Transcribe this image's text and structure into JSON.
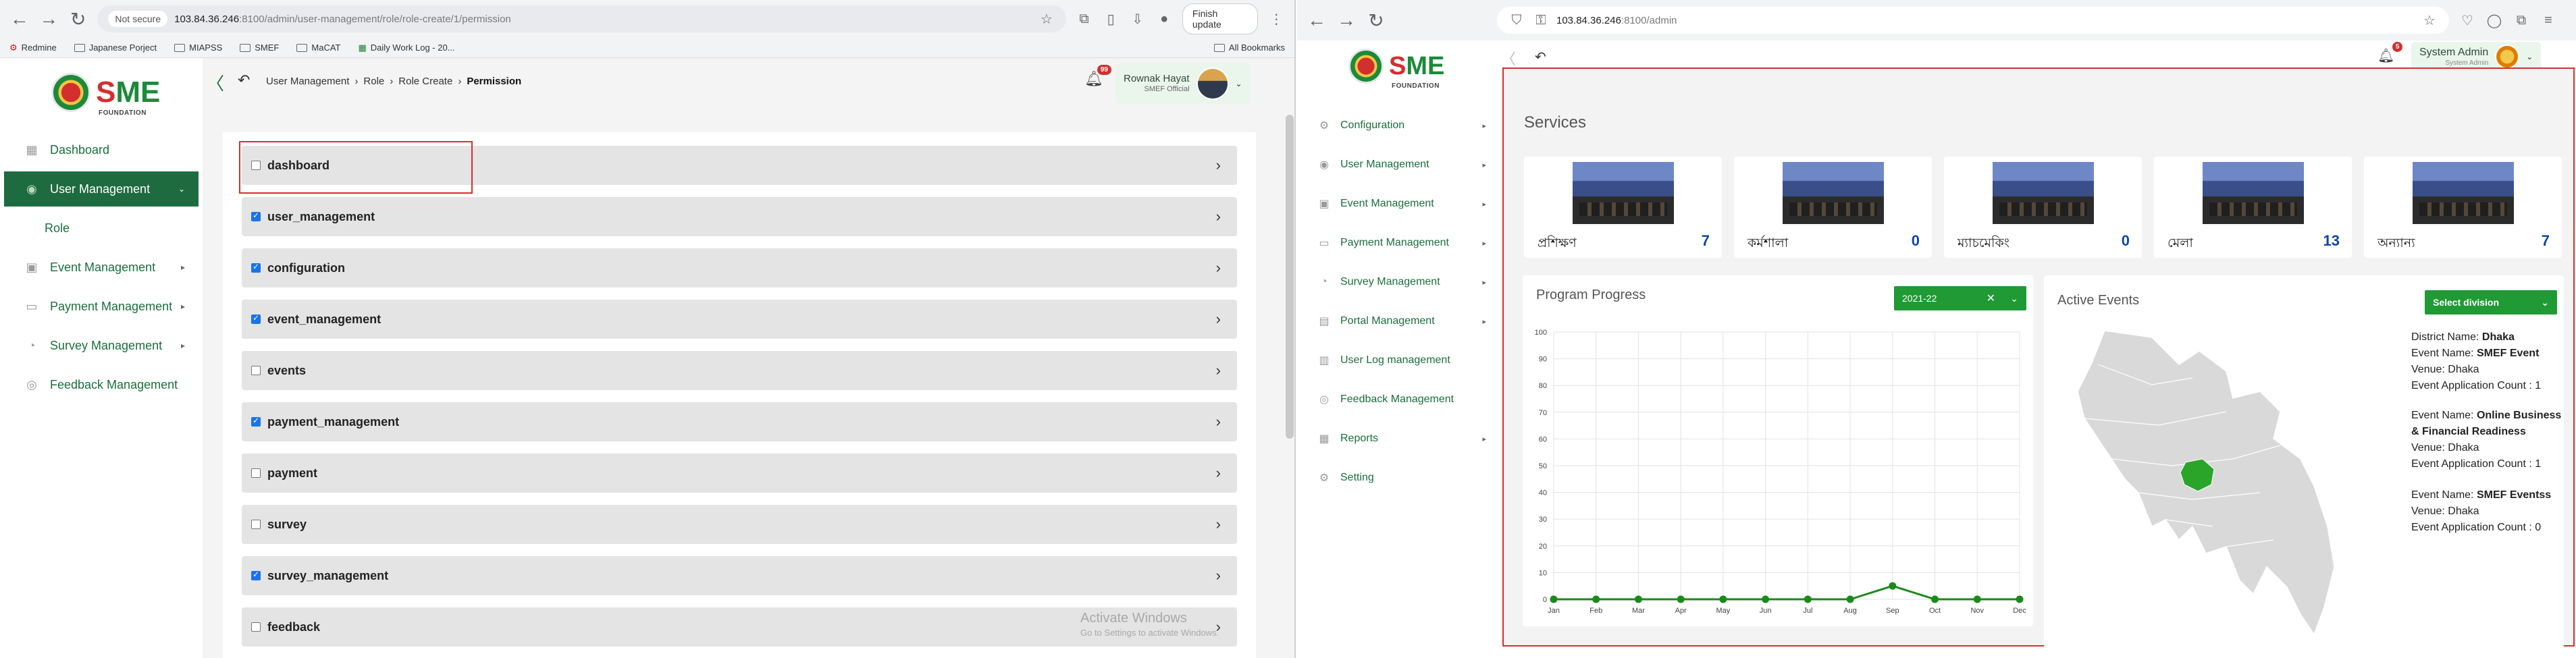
{
  "left": {
    "browser": {
      "not_secure": "Not secure",
      "url_host": "103.84.36.246",
      "url_rest": ":8100/admin/user-management/role/role-create/1/permission",
      "finish_update": "Finish update",
      "bookmarks": [
        "Redmine",
        "Japanese Porject",
        "MIAPSS",
        "SMEF",
        "MaCAT",
        "Daily Work Log - 20..."
      ],
      "all_bookmarks": "All Bookmarks"
    },
    "logo": {
      "s": "S",
      "me": "ME",
      "foundation": "FOUNDATION"
    },
    "sidebar": {
      "items": [
        {
          "label": "Dashboard",
          "icon": "dashboard-icon"
        },
        {
          "label": "User Management",
          "icon": "user-management-icon"
        },
        {
          "label": "Role"
        },
        {
          "label": "Event Management",
          "icon": "event-icon"
        },
        {
          "label": "Payment Management",
          "icon": "payment-icon"
        },
        {
          "label": "Survey Management",
          "icon": "survey-icon"
        },
        {
          "label": "Feedback Management",
          "icon": "feedback-icon"
        }
      ]
    },
    "header": {
      "breadcrumb": [
        "User Management",
        "Role",
        "Role Create",
        "Permission"
      ],
      "notifications": "99",
      "user_name": "Rownak Hayat",
      "user_role": "SMEF Official"
    },
    "permissions": [
      {
        "label": "dashboard",
        "checked": false
      },
      {
        "label": "user_management",
        "checked": true
      },
      {
        "label": "configuration",
        "checked": true
      },
      {
        "label": "event_management",
        "checked": true
      },
      {
        "label": "events",
        "checked": false
      },
      {
        "label": "payment_management",
        "checked": true
      },
      {
        "label": "payment",
        "checked": false
      },
      {
        "label": "survey",
        "checked": false
      },
      {
        "label": "survey_management",
        "checked": true
      },
      {
        "label": "feedback",
        "checked": false
      }
    ],
    "watermark": {
      "line1": "Activate Windows",
      "line2": "Go to Settings to activate Windows."
    }
  },
  "right": {
    "browser": {
      "url_host": "103.84.36.246",
      "url_rest": ":8100/admin"
    },
    "sidebar": {
      "items": [
        {
          "label": "Configuration",
          "has_caret": true
        },
        {
          "label": "User Management",
          "has_caret": true
        },
        {
          "label": "Event Management",
          "has_caret": true
        },
        {
          "label": "Payment Management",
          "has_caret": true
        },
        {
          "label": "Survey Management",
          "has_caret": true
        },
        {
          "label": "Portal Management",
          "has_caret": true
        },
        {
          "label": "User Log management",
          "has_caret": false
        },
        {
          "label": "Feedback Management",
          "has_caret": false
        },
        {
          "label": "Reports",
          "has_caret": true
        },
        {
          "label": "Setting",
          "has_caret": false
        }
      ]
    },
    "header": {
      "notifications": "5",
      "user_name": "System Admin",
      "user_role": "System Admin"
    },
    "services_title": "Services",
    "services": [
      {
        "name": "প্রশিক্ষণ",
        "count": "7"
      },
      {
        "name": "কর্মশালা",
        "count": "0"
      },
      {
        "name": "ম্যাচমেকিং",
        "count": "0"
      },
      {
        "name": "মেলা",
        "count": "13"
      },
      {
        "name": "অন্যান্য",
        "count": "7"
      }
    ],
    "program_progress": {
      "title": "Program Progress",
      "year": "2021-22",
      "clear": "✕"
    },
    "active_events": {
      "title": "Active Events",
      "select": "Select division",
      "district_label": "District Name: ",
      "district": "Dhaka",
      "events": [
        {
          "label": "Event Name: ",
          "name": "SMEF Event",
          "venue": "Venue: Dhaka",
          "count": "Event Application Count : 1"
        },
        {
          "label": "Event Name: ",
          "name": "Online Business & Financial Readiness",
          "venue": "Venue: Dhaka",
          "count": "Event Application Count : 1"
        },
        {
          "label": "Event Name: ",
          "name": "SMEF Eventss",
          "venue": "Venue: Dhaka",
          "count": "Event Application Count : 0"
        }
      ]
    },
    "colors": {
      "accent": "#1e6b40",
      "button": "#1f9a35",
      "highlight": "#d32f2f"
    }
  },
  "chart_data": {
    "type": "line",
    "title": "Program Progress",
    "categories": [
      "Jan",
      "Feb",
      "Mar",
      "Apr",
      "May",
      "Jun",
      "Jul",
      "Aug",
      "Sep",
      "Oct",
      "Nov",
      "Dec"
    ],
    "values": [
      0,
      0,
      0,
      0,
      0,
      0,
      0,
      0,
      5,
      0,
      0,
      0
    ],
    "ylim": [
      0,
      100
    ],
    "yticks": [
      0,
      10,
      20,
      30,
      40,
      50,
      60,
      70,
      80,
      90,
      100
    ],
    "grid": true,
    "color": "#1a8a1a"
  }
}
